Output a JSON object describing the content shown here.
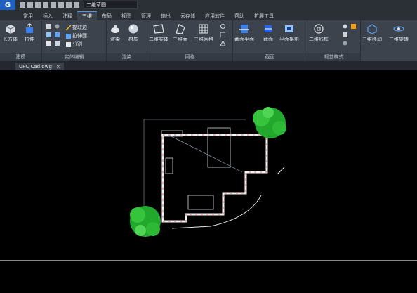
{
  "window": {
    "workspace": "二维草图"
  },
  "menu_tabs": [
    "常用",
    "插入",
    "注释",
    "三维",
    "布局",
    "视图",
    "管理",
    "输出",
    "云存储",
    "应用软件",
    "帮助",
    "扩展工具"
  ],
  "active_tab": "三维",
  "ribbon": {
    "groups": [
      {
        "label": "建模",
        "tools": [
          "长方体",
          "拉伸"
        ]
      },
      {
        "label": "实体编辑",
        "tools": [
          "提取边",
          "拉伸面",
          "分割"
        ]
      },
      {
        "label": "渲染",
        "tools": [
          "渲染",
          "材质"
        ]
      },
      {
        "label": "网格",
        "tools": [
          "二维实体",
          "三维面",
          "三维网格"
        ]
      },
      {
        "label": "截面",
        "tools": [
          "截面平面",
          "截面",
          "平面摄影"
        ]
      },
      {
        "label": "视觉样式",
        "tools": [
          "二维线框"
        ]
      },
      {
        "label": "",
        "tools": [
          "三维移动",
          "三维旋转"
        ]
      }
    ]
  },
  "document_tab": {
    "name": "UPC Cad.dwg",
    "close": "×"
  }
}
